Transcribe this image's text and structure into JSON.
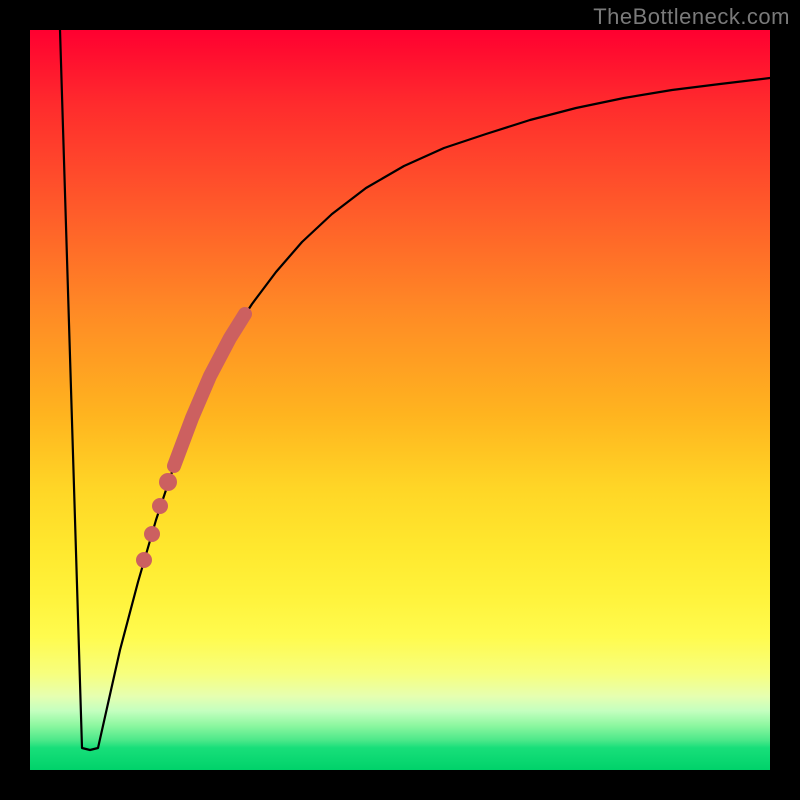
{
  "watermark": "TheBottleneck.com",
  "colors": {
    "frame": "#000000",
    "curve": "#000000",
    "highlight": "#cc6060"
  },
  "chart_data": {
    "type": "line",
    "title": "",
    "xlabel": "",
    "ylabel": "",
    "xlim": [
      0,
      100
    ],
    "ylim": [
      0,
      100
    ],
    "grid": false,
    "legend": false,
    "background_gradient": {
      "top": "red",
      "upper_mid": "orange",
      "mid": "yellow",
      "bottom": "green"
    },
    "curve": {
      "x": [
        4,
        6,
        7,
        8,
        9,
        10,
        12,
        14,
        16,
        18,
        20,
        22,
        24,
        26,
        28,
        30,
        34,
        38,
        42,
        46,
        50,
        55,
        60,
        65,
        70,
        75,
        80,
        85,
        90,
        95,
        100
      ],
      "y": [
        100,
        40,
        6,
        3,
        3,
        6,
        16,
        26,
        36,
        44,
        51,
        57,
        62,
        66,
        70,
        73,
        78,
        81,
        84,
        86,
        88,
        89.5,
        91,
        92,
        93,
        93.8,
        94.4,
        95,
        95.4,
        95.8,
        96
      ]
    },
    "highlighted_segment": {
      "x_range": [
        18,
        24
      ],
      "description": "thick salmon overlay on rising branch"
    },
    "highlighted_points": [
      {
        "x": 15.0,
        "y": 31
      },
      {
        "x": 15.8,
        "y": 35
      },
      {
        "x": 16.6,
        "y": 39
      },
      {
        "x": 17.4,
        "y": 42
      }
    ],
    "notch": {
      "x_range": [
        7,
        9
      ],
      "y": 3,
      "description": "flat bottom of V-dip"
    }
  }
}
